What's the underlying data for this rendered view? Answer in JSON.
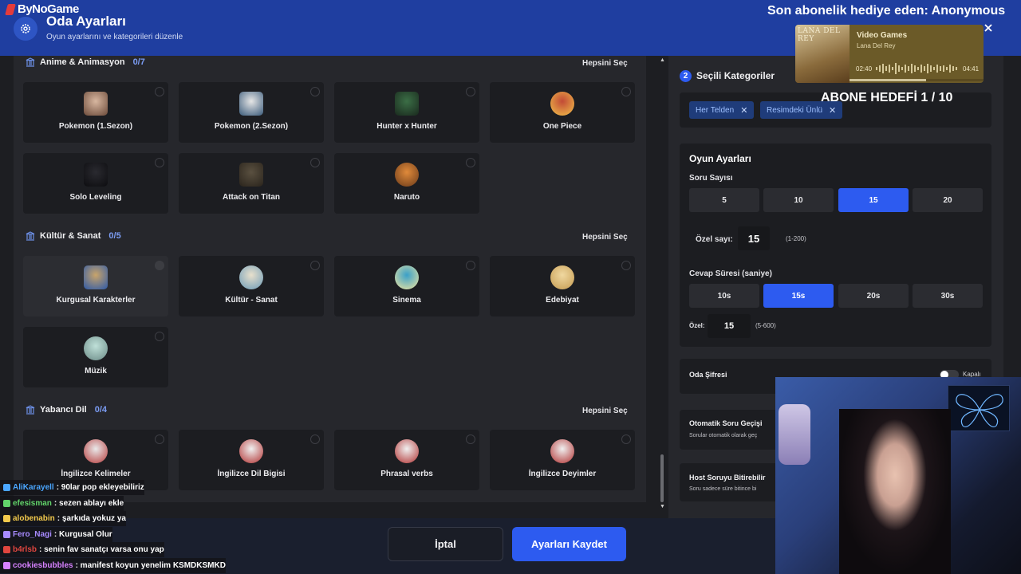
{
  "header": {
    "brand": "ByNoGame",
    "title": "Oda Ayarları",
    "subtitle": "Oyun ayarlarını ve kategorileri düzenle"
  },
  "overlay": {
    "subscriber_text": "Son abonelik hediye eden: Anonymous",
    "goal_text": "ABONE HEDEFİ 1 / 10",
    "music": {
      "album_text": "LANA DEL REY",
      "song": "Video Games",
      "artist": "Lana Del Rey",
      "elapsed": "02:40",
      "total": "04:41",
      "progress": 0.57
    }
  },
  "left": {
    "sections": [
      {
        "title": "Anime & Animasyon",
        "count": "0/7",
        "select_all": "Hepsini Seç",
        "items": [
          "Pokemon (1.Sezon)",
          "Pokemon (2.Sezon)",
          "Hunter x Hunter",
          "One Piece",
          "Solo Leveling",
          "Attack on Titan",
          "Naruto"
        ]
      },
      {
        "title": "Kültür & Sanat",
        "count": "0/5",
        "select_all": "Hepsini Seç",
        "items": [
          "Kurgusal Karakterler",
          "Kültür - Sanat",
          "Sinema",
          "Edebiyat",
          "Müzik"
        ]
      },
      {
        "title": "Yabancı Dil",
        "count": "0/4",
        "select_all": "Hepsini Seç",
        "items": [
          "İngilizce Kelimeler",
          "İngilizce Dil Bigisi",
          "Phrasal verbs",
          "İngilizce Deyimler"
        ]
      }
    ]
  },
  "right": {
    "step": "2",
    "selected_title": "Seçili Kategoriler",
    "chips": [
      "Her Telden",
      "Resimdeki Ünlü"
    ],
    "settings_title": "Oyun Ayarları",
    "question_count_label": "Soru Sayısı",
    "question_options": [
      "5",
      "10",
      "15",
      "20"
    ],
    "custom_count_label": "Özel sayı:",
    "custom_count_value": "15",
    "custom_count_hint": "(1-200)",
    "answer_time_label": "Cevap Süresi (saniye)",
    "time_options": [
      "10s",
      "15s",
      "20s",
      "30s"
    ],
    "custom_time_label": "Özel:",
    "custom_time_value": "15",
    "custom_time_hint": "(5-600)",
    "room_password_label": "Oda Şifresi",
    "room_password_state": "Kapalı",
    "auto_skip_title": "Otomatik Soru Geçişi",
    "auto_skip_sub": "Sorular otomatik olarak geç",
    "host_end_title": "Host Soruyu Bitirebilir",
    "host_end_sub": "Soru sadece süre bitince bi"
  },
  "footer": {
    "cancel": "İptal",
    "save": "Ayarları Kaydet"
  },
  "chat": [
    {
      "user": "AliKarayell",
      "msg": ": 90lar pop ekleyebiliriz",
      "color": "#4aa6ff"
    },
    {
      "user": "efesisman",
      "msg": ": sezen ablayı ekle",
      "color": "#62d46a"
    },
    {
      "user": "alobenabin",
      "msg": ": şarkıda yokuz ya",
      "color": "#f2c94c"
    },
    {
      "user": "Fero_Nagi",
      "msg": ": Kurgusal Olur",
      "color": "#a88bff"
    },
    {
      "user": "b4rlsb",
      "msg": ": senin fav sanatçı varsa onu yap",
      "color": "#e0463f"
    },
    {
      "user": "cookiesbubbles",
      "msg": ": manifest koyun yenelim KSMDKSMKD",
      "color": "#d782ff"
    }
  ]
}
